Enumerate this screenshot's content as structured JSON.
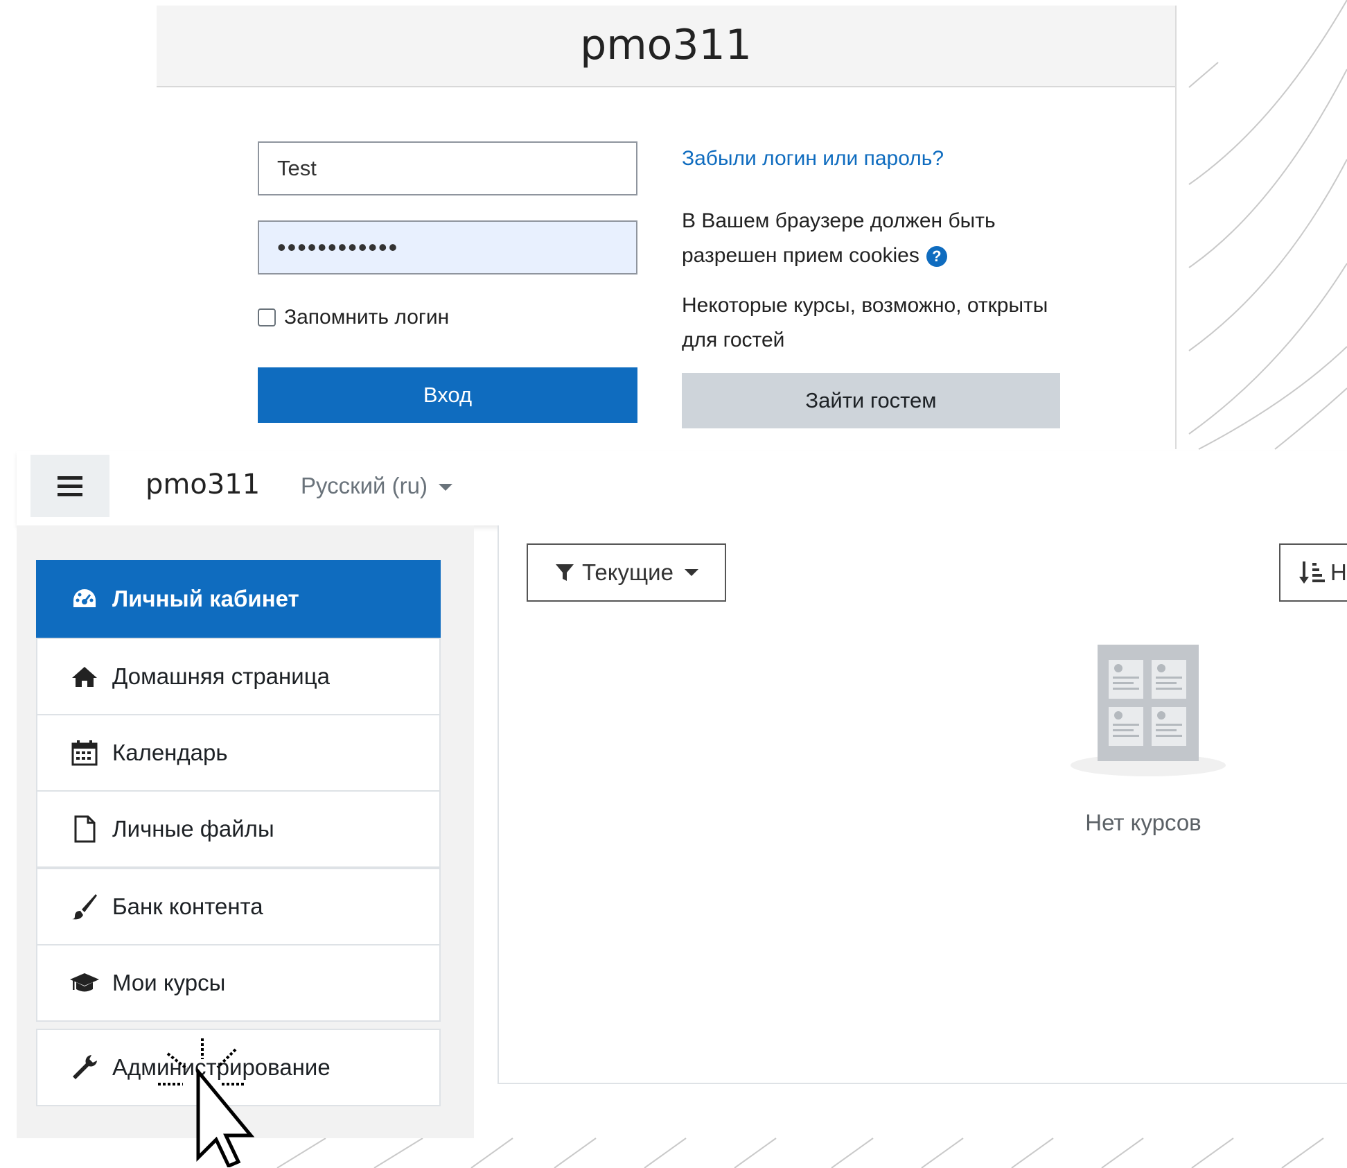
{
  "login": {
    "site_title": "pmo311",
    "username_value": "Test",
    "password_value": "••••••••••••",
    "remember_label": "Запомнить логин",
    "login_button": "Вход",
    "forgot_link": "Забыли логин или пароль?",
    "cookies_text": "В Вашем браузере должен быть разрешен прием cookies",
    "guests_text": "Некоторые курсы, возможно, открыты для гостей",
    "guest_button": "Зайти гостем"
  },
  "navbar": {
    "brand": "pmo311",
    "language": "Русский (ru)"
  },
  "drawer": {
    "items": [
      {
        "label": "Личный кабинет",
        "icon": "dashboard-icon",
        "active": true
      },
      {
        "label": "Домашняя страница",
        "icon": "home-icon"
      },
      {
        "label": "Календарь",
        "icon": "calendar-icon"
      },
      {
        "label": "Личные файлы",
        "icon": "file-icon"
      },
      {
        "label": "Банк контента",
        "icon": "brush-icon"
      },
      {
        "label": "Мои курсы",
        "icon": "graduation-cap-icon"
      },
      {
        "label": "Администрирование",
        "icon": "wrench-icon"
      }
    ]
  },
  "main": {
    "filter_label": "Текущие",
    "sort_label": "Н",
    "empty_text": "Нет курсов"
  },
  "colors": {
    "accent": "#0f6cbf",
    "guest_button": "#ced4da",
    "drawer_bg": "#f2f2f2"
  }
}
